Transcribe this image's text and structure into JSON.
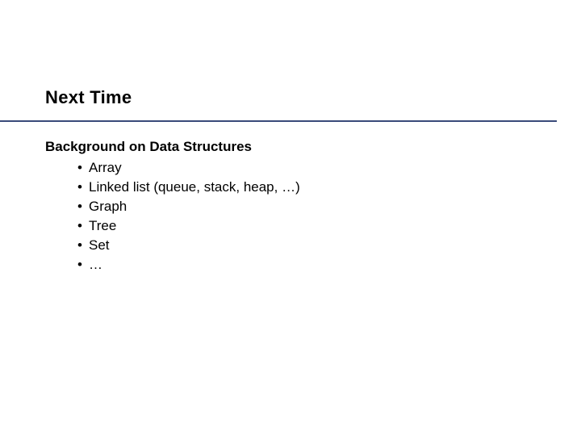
{
  "slide": {
    "title": "Next Time",
    "section_heading": "Background on Data Structures",
    "bullets": [
      "Array",
      "Linked list (queue, stack, heap, …)",
      "Graph",
      "Tree",
      "Set",
      "…"
    ]
  }
}
